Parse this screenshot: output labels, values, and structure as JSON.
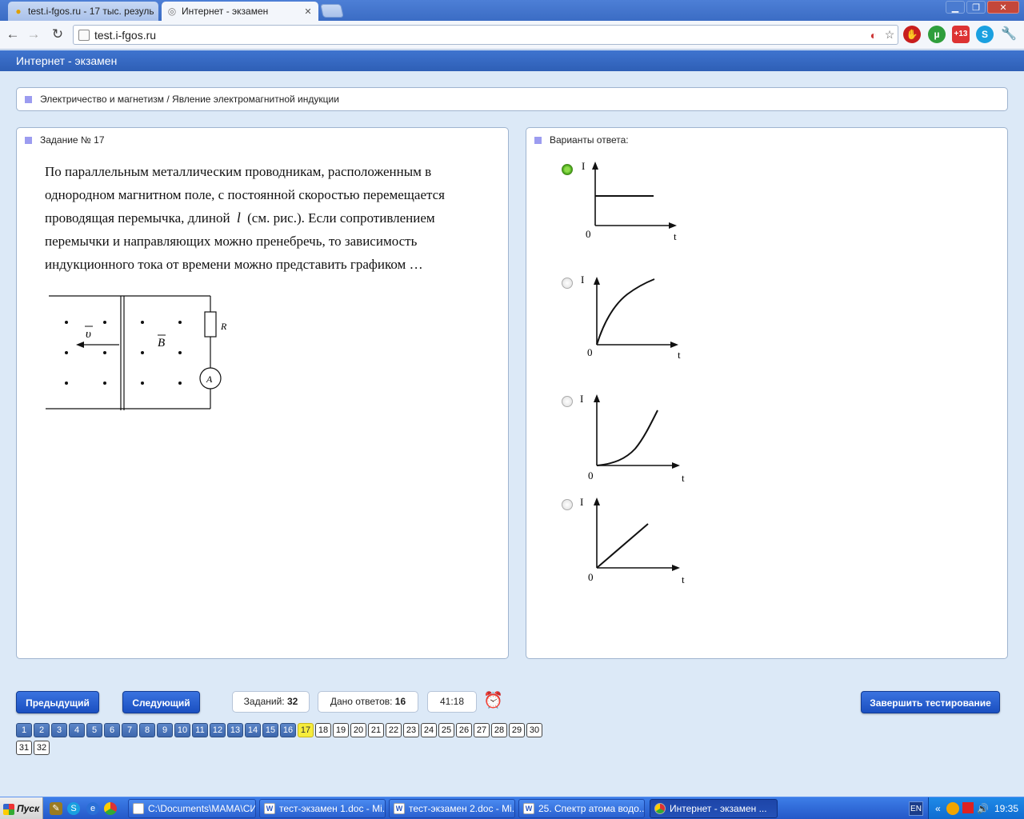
{
  "browser": {
    "tabs": [
      {
        "label": "test.i-fgos.ru - 17 тыс. резуль",
        "active": false
      },
      {
        "label": "Интернет - экзамен",
        "active": true
      }
    ],
    "url": "test.i-fgos.ru",
    "extensions": {
      "badge": "+13"
    }
  },
  "app": {
    "title": "Интернет - экзамен",
    "breadcrumb": "Электричество и магнетизм / Явление электромагнитной индукции"
  },
  "question": {
    "header": "Задание № 17",
    "text_part1": "По параллельным металлическим проводникам, расположенным в однородном магнитном поле, с постоянной скоростью перемещается проводящая перемычка, длиной",
    "text_var": "l",
    "text_part2": "(см. рис.). Если сопротивлением перемычки и направляющих можно пренебречь, то зависимость индукционного тока от времени можно представить графиком …",
    "figure": {
      "velocity": "υ",
      "field": "B",
      "resistor": "R",
      "ammeter": "A"
    }
  },
  "answers": {
    "header": "Варианты ответа:",
    "axis_y": "I",
    "axis_x": "t",
    "origin": "0",
    "options": [
      {
        "name": "constant",
        "selected": true
      },
      {
        "name": "saturating",
        "selected": false
      },
      {
        "name": "accelerating",
        "selected": false
      },
      {
        "name": "linear",
        "selected": false
      }
    ]
  },
  "footer": {
    "prev_label": "Предыдущий",
    "next_label": "Следующий",
    "tasks_label": "Заданий:",
    "tasks_value": "32",
    "answered_label": "Дано ответов:",
    "answered_value": "16",
    "timer": "41:18",
    "finish_label": "Завершить тестирование",
    "current_question": 17,
    "total_questions": 32
  },
  "taskbar": {
    "start_label": "Пуск",
    "items": [
      {
        "label": "C:\\Documents\\МАМА\\СИ...",
        "active": false
      },
      {
        "label": "тест-экзамен 1.doc - Mi...",
        "active": false
      },
      {
        "label": "тест-экзамен 2.doc - Mi...",
        "active": false
      },
      {
        "label": "25. Спектр атома водо...",
        "active": false
      },
      {
        "label": "Интернет - экзамен ...",
        "active": true
      }
    ],
    "lang": "EN",
    "clock": "19:35"
  }
}
